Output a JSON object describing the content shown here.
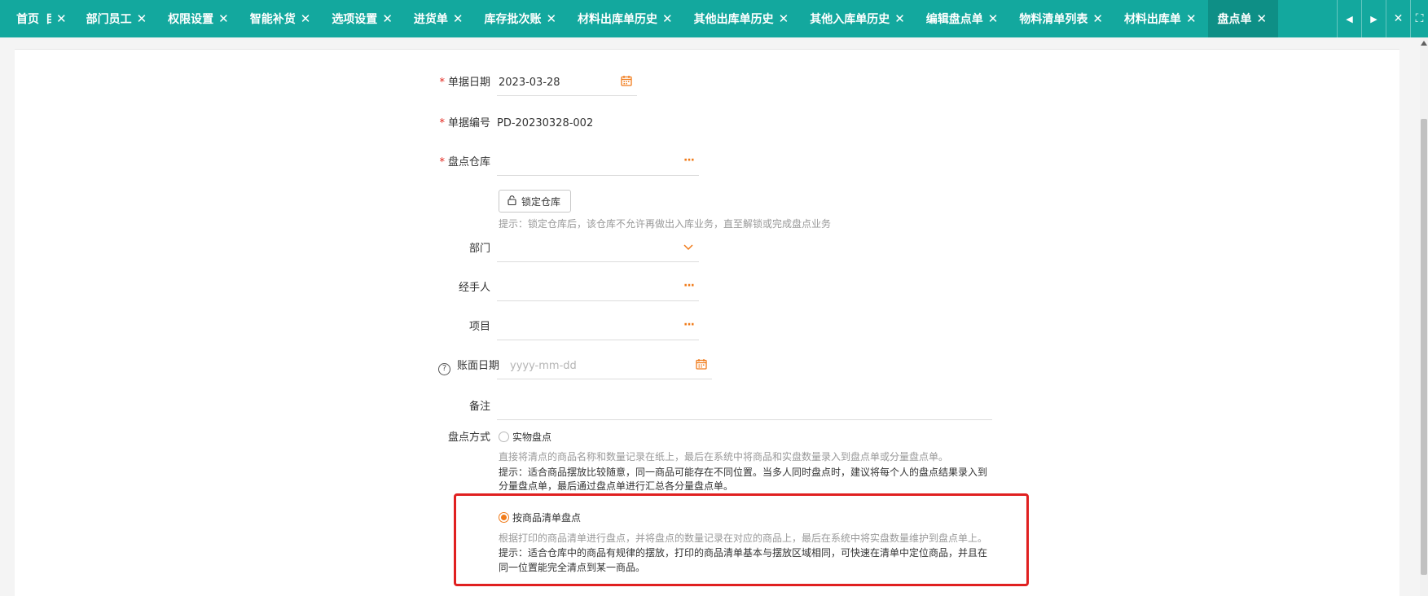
{
  "tabs": [
    {
      "label": "首页",
      "active": false
    },
    {
      "label": "目",
      "active": false
    },
    {
      "label": "部门员工",
      "active": false
    },
    {
      "label": "权限设置",
      "active": false
    },
    {
      "label": "智能补货",
      "active": false
    },
    {
      "label": "选项设置",
      "active": false
    },
    {
      "label": "进货单",
      "active": false
    },
    {
      "label": "库存批次账",
      "active": false
    },
    {
      "label": "材料出库单历史",
      "active": false
    },
    {
      "label": "其他出库单历史",
      "active": false
    },
    {
      "label": "其他入库单历史",
      "active": false
    },
    {
      "label": "编辑盘点单",
      "active": false
    },
    {
      "label": "物料清单列表",
      "active": false
    },
    {
      "label": "材料出库单",
      "active": false
    },
    {
      "label": "盘点单",
      "active": true
    }
  ],
  "tab_close_glyph": "✕",
  "controls": {
    "prev": "◀",
    "next": "▶",
    "close": "✕",
    "fullscreen": "⛶"
  },
  "form": {
    "doc_date": {
      "label": "单据日期",
      "value": "2023-03-28"
    },
    "doc_no": {
      "label": "单据编号",
      "value": "PD-20230328-002"
    },
    "warehouse": {
      "label": "盘点仓库",
      "value": ""
    },
    "lock_button": "锁定仓库",
    "lock_hint": "提示：锁定仓库后，该仓库不允许再做出入库业务，直至解锁或完成盘点业务",
    "department": {
      "label": "部门",
      "value": ""
    },
    "handler": {
      "label": "经手人",
      "value": ""
    },
    "project": {
      "label": "项目",
      "value": ""
    },
    "book_date": {
      "label": "账面日期",
      "placeholder": "yyyy-mm-dd"
    },
    "remark": {
      "label": "备注",
      "value": ""
    },
    "method": {
      "label": "盘点方式",
      "option1": {
        "label": "实物盘点",
        "desc": "直接将清点的商品名称和数量记录在纸上，最后在系统中将商品和实盘数量录入到盘点单或分量盘点单。",
        "tip1": "提示：适合商品摆放比较随意，同一商品可能存在不同位置。当多人同时盘点时，建议将每个人的盘点结果录入到",
        "tip2": "分量盘点单，最后通过盘点单进行汇总各分量盘点单。",
        "checked": false
      },
      "option2": {
        "label": "按商品清单盘点",
        "desc": "根据打印的商品清单进行盘点，并将盘点的数量记录在对应的商品上，最后在系统中将实盘数量维护到盘点单上。",
        "tip1": "提示：适合仓库中的商品有规律的摆放，打印的商品清单基本与摆放区域相同，可快速在清单中定位商品，并且在",
        "tip2": "同一位置能完全清点到某一商品。",
        "checked": true
      }
    }
  },
  "icons": {
    "calendar": "calendar-icon",
    "ellipsis": "···",
    "chevron": "chevron-down-icon"
  },
  "colors": {
    "tabbar": "#13a89e",
    "active_tab": "#0e8f86",
    "accent": "#f07b1a",
    "required": "#e2231a",
    "highlight_box": "#e02020"
  }
}
